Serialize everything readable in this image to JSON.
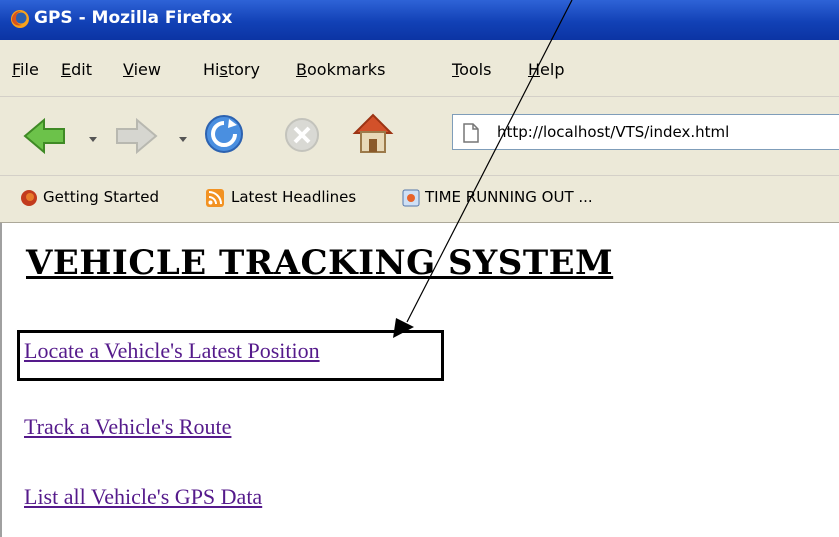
{
  "window": {
    "title": "GPS - Mozilla Firefox"
  },
  "menu": {
    "items": [
      {
        "hotkey": "F",
        "rest": "ile"
      },
      {
        "hotkey": "E",
        "rest": "dit"
      },
      {
        "hotkey": "V",
        "rest": "iew"
      },
      {
        "pre": "Hi",
        "hotkey": "s",
        "rest": "tory"
      },
      {
        "hotkey": "B",
        "rest": "ookmarks"
      },
      {
        "hotkey": "T",
        "rest": "ools"
      },
      {
        "hotkey": "H",
        "rest": "elp"
      }
    ]
  },
  "navigation": {
    "url": "http://localhost/VTS/index.html",
    "buttons": [
      "back-icon",
      "forward-icon",
      "reload-icon",
      "stop-icon",
      "home-icon"
    ]
  },
  "bookmarks": {
    "items": [
      {
        "label": "Getting Started",
        "icon": "firefox-logo-icon"
      },
      {
        "label": "Latest Headlines",
        "icon": "rss-feed-icon"
      },
      {
        "label": "TIME RUNNING OUT ...",
        "icon": "bookmark-page-icon"
      }
    ]
  },
  "page": {
    "heading": "VEHICLE TRACKING SYSTEM",
    "links": [
      "Locate a Vehicle's Latest Position",
      "Track a Vehicle's Route",
      "List all Vehicle's GPS Data"
    ]
  },
  "colors": {
    "title_bar": "#1241b6",
    "chrome": "#ece9d8",
    "visited_link": "#551a8b",
    "annotation": "#000000"
  }
}
